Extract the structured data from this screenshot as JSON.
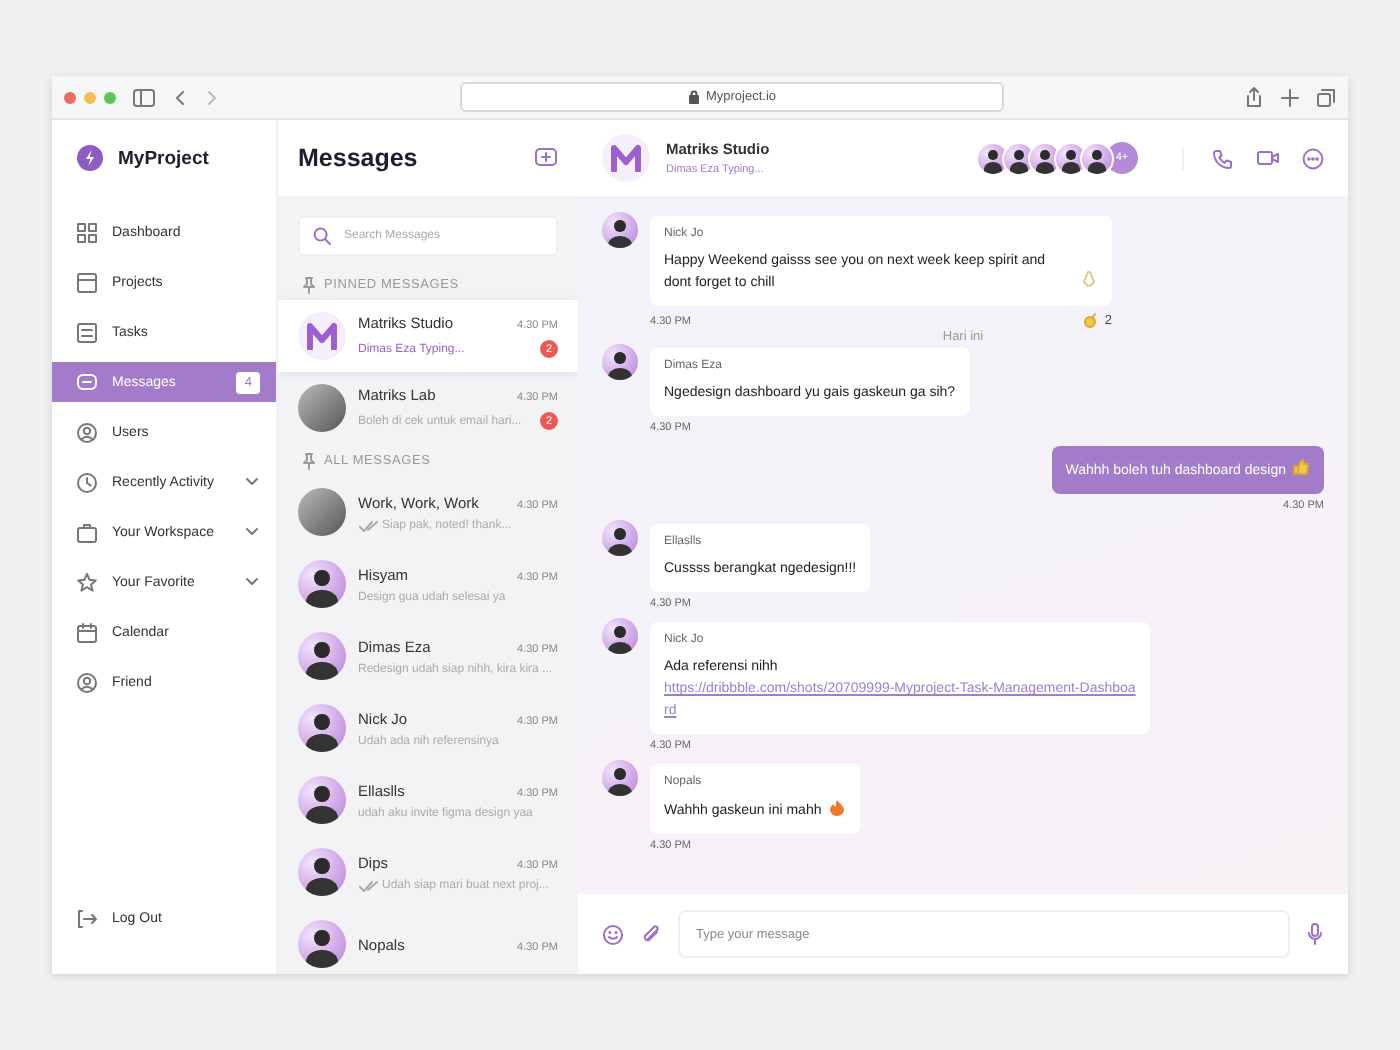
{
  "browser": {
    "url": "Myproject.io"
  },
  "sidebar": {
    "brand": "MyProject",
    "items": [
      {
        "label": "Dashboard",
        "selected": false,
        "expandable": false
      },
      {
        "label": "Projects",
        "selected": false,
        "expandable": false
      },
      {
        "label": "Tasks",
        "selected": false,
        "expandable": false
      },
      {
        "label": "Messages",
        "selected": true,
        "expandable": false,
        "badge": "4"
      },
      {
        "label": "Users",
        "selected": false,
        "expandable": false
      },
      {
        "label": "Recently Activity",
        "selected": false,
        "expandable": true
      },
      {
        "label": "Your Workspace",
        "selected": false,
        "expandable": true
      },
      {
        "label": "Your Favorite",
        "selected": false,
        "expandable": true
      },
      {
        "label": "Calendar",
        "selected": false,
        "expandable": false
      },
      {
        "label": "Friend",
        "selected": false,
        "expandable": false
      }
    ],
    "logout": "Log Out"
  },
  "conversations": {
    "title": "Messages",
    "search": {
      "placeholder": "Search Messages"
    },
    "sections": [
      {
        "title": "PINNED MESSAGES",
        "items": [
          {
            "kind": "logo",
            "name": "Matriks Studio",
            "preview": "Dimas Eza Typing...",
            "typing": true,
            "read": false,
            "time": "4.30 PM",
            "unread": "2",
            "selected": true
          },
          {
            "kind": "photo",
            "name": "Matriks Lab",
            "preview": "Boleh di cek untuk email hari...",
            "typing": false,
            "read": false,
            "time": "4.30 PM",
            "unread": "2",
            "selected": false
          }
        ]
      },
      {
        "title": "ALL MESSAGES",
        "items": [
          {
            "kind": "photo",
            "name": "Work, Work, Work",
            "preview": "Siap pak, noted! thank...",
            "typing": false,
            "read": true,
            "time": "4.30 PM",
            "selected": false
          },
          {
            "kind": "person",
            "name": "Hisyam",
            "preview": "Design gua udah selesai ya",
            "typing": false,
            "read": false,
            "time": "4.30 PM",
            "selected": false
          },
          {
            "kind": "person",
            "name": "Dimas Eza",
            "preview": "Redesign udah siap nihh, kira kira ...",
            "typing": false,
            "read": false,
            "time": "4.30 PM",
            "selected": false
          },
          {
            "kind": "person",
            "name": "Nick Jo",
            "preview": "Udah ada nih referensinya",
            "typing": false,
            "read": false,
            "time": "4.30 PM",
            "selected": false
          },
          {
            "kind": "person",
            "name": "Ellaslls",
            "preview": "udah aku invite figma design yaa",
            "typing": false,
            "read": false,
            "time": "4.30 PM",
            "selected": false
          },
          {
            "kind": "person",
            "name": "Dips",
            "preview": "Udah siap mari buat next proj...",
            "typing": false,
            "read": true,
            "time": "4.30 PM",
            "selected": false
          },
          {
            "kind": "person",
            "name": "Nopals",
            "time": "4.30 PM",
            "selected": false
          }
        ]
      }
    ]
  },
  "chat": {
    "title": "Matriks Studio",
    "status": "Dimas Eza Typing...",
    "more_members": "4+",
    "messages": [
      {
        "kind": "incoming",
        "sender": "Nick Jo",
        "text": "Happy Weekend gaisss see you on next week keep spirit and dont forget to chill",
        "time": "4.30 PM",
        "reaction": "2"
      },
      {
        "kind": "divider",
        "text": "Hari ini"
      },
      {
        "kind": "incoming",
        "sender": "Dimas Eza",
        "text": "Ngedesign dashboard yu gais gaskeun ga sih?",
        "time": "4.30 PM"
      },
      {
        "kind": "outgoing",
        "text": "Wahhh boleh tuh dashboard design",
        "time": "4.30 PM"
      },
      {
        "kind": "incoming",
        "sender": "Ellaslls",
        "text": "Cussss berangkat ngedesign!!!",
        "time": "4.30 PM"
      },
      {
        "kind": "incoming",
        "sender": "Nick Jo",
        "text": "Ada referensi nihh",
        "link": "https://dribbble.com/shots/20709999-Myproject-Task-Management-Dashboard",
        "time": "4.30 PM"
      },
      {
        "kind": "incoming",
        "sender": "Nopals",
        "text": "Wahhh gaskeun ini mahh",
        "time": "4.30 PM"
      }
    ],
    "composer": {
      "placeholder": "Type your message"
    }
  }
}
